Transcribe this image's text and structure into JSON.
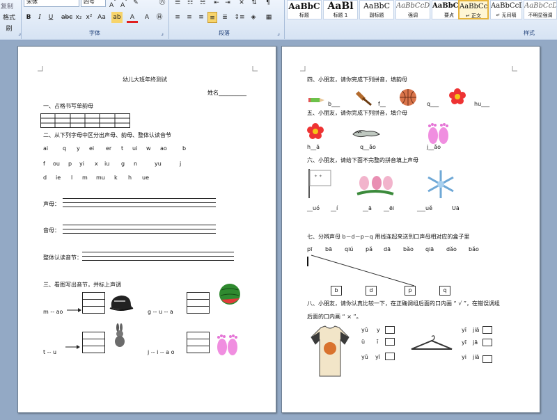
{
  "ribbon": {
    "left_items": [
      "复制",
      "格式刷"
    ],
    "font_name": "宋体",
    "font_size": "四号",
    "groups": {
      "font": "字体",
      "paragraph": "段落",
      "styles": "样式"
    },
    "styles": [
      {
        "sample": "AaBbC",
        "name": "标题"
      },
      {
        "sample": "AaBl",
        "name": "标题 1"
      },
      {
        "sample": "AaBbC",
        "name": "副标题"
      },
      {
        "sample": "AaBbCcD",
        "name": "强调"
      },
      {
        "sample": "AaBbCcD",
        "name": "要点"
      },
      {
        "sample": "AaBbCcDd",
        "name": "↵ 正文"
      },
      {
        "sample": "AaBbCcDd",
        "name": "↵ 无间隔"
      },
      {
        "sample": "AaBbCcDd",
        "name": "不明显强调"
      }
    ],
    "colors": {
      "ribbon": "#dfe9f5",
      "accent": "#22427a",
      "highlight": "#f7d46b",
      "font_red": "#e02020"
    }
  },
  "page1": {
    "title": "幼儿大班年终测试",
    "name_label": "姓名__________",
    "q1": "一、占格书写单韵母",
    "q2": "二、从下列字母中区分出声母、韵母、整体认读音节",
    "letters": [
      [
        "ai",
        "q",
        "y",
        "ei",
        "er",
        "t",
        "ui",
        "w",
        "ao",
        "b"
      ],
      [
        "f",
        "ou",
        "p",
        "yi",
        "x",
        "iu",
        "g",
        "n",
        "yu",
        "j"
      ],
      [
        "d",
        "ie",
        "l",
        "m",
        "mu",
        "k",
        "h",
        "ue"
      ]
    ],
    "shengmu": "声母：",
    "yunmu": "音母：",
    "zhengti": "整体认读音节：",
    "q3": "三、看图写出音节，并标上声调",
    "items": [
      "m -- ao",
      "g -- u -- a",
      "t -- u",
      "j -- i -- a o"
    ]
  },
  "page2": {
    "q4": "四、小朋友，请你完成下列拼音，填韵母",
    "q4_items": [
      "b___",
      "f__",
      "q___",
      "hu___"
    ],
    "q5": "五、小朋友，请你完成下列拼音，填介母",
    "q5_items": [
      "h__ā",
      "q__ǎo",
      "j__ǎo"
    ],
    "q6": "六、小朋友，请给下面不完整的拼音填上声母",
    "q6_items": [
      "__uó",
      "__í",
      "__ā",
      "__ēi",
      "___uě",
      "Uā"
    ],
    "q7": "七、分辨声母 b－d－p－q 用线连起来送到口声母相对应的盒子里",
    "q7_syllables": [
      "pī",
      "bā",
      "qiú",
      "pǎ",
      "dā",
      "bǎo",
      "qiā",
      "dǎo",
      "bǎo"
    ],
    "q7_boxes": [
      "b",
      "d",
      "p",
      "q"
    ],
    "q8_line1": "八、小朋友，请你认真比较一下，在正确调组后面的口内画 “ √ ”，在错误调组",
    "q8_line2": "后面的口内画 “ × ”。",
    "q8_left": [
      [
        "yǔ",
        "y"
      ],
      [
        "ü",
        "ī"
      ],
      [
        "yǔ",
        "yī"
      ]
    ],
    "q8_right": [
      [
        "yī",
        "jiā"
      ],
      [
        "yī",
        "jā"
      ],
      [
        "yi",
        "jiā"
      ]
    ]
  }
}
